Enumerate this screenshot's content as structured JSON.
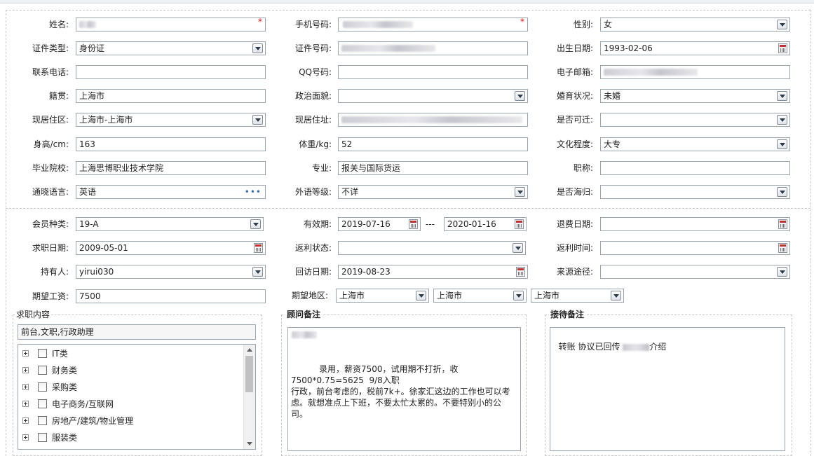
{
  "basic": {
    "name_label": "姓名:",
    "phone_label": "手机号码:",
    "gender_label": "性别:",
    "gender_value": "女",
    "id_type_label": "证件类型:",
    "id_type_value": "身份证",
    "id_number_label": "证件号码:",
    "birth_label": "出生日期:",
    "birth_value": "1993-02-06",
    "contact_label": "联系电话:",
    "qq_label": "QQ号码:",
    "email_label": "电子邮箱:",
    "native_label": "籍贯:",
    "native_value": "上海市",
    "political_label": "政治面貌:",
    "political_value": "",
    "marital_label": "婚育状况:",
    "marital_value": "未婚",
    "residence_label": "现居住区:",
    "residence_value": "上海市-上海市",
    "address_label": "现居住址:",
    "relocate_label": "是否可迁:",
    "relocate_value": "",
    "height_label": "身高/cm:",
    "height_value": "163",
    "weight_label": "体重/kg:",
    "weight_value": "52",
    "education_label": "文化程度:",
    "education_value": "大专",
    "school_label": "毕业院校:",
    "school_value": "上海思博职业技术学院",
    "major_label": "专业:",
    "major_value": "报关与国际货运",
    "title_label": "职称:",
    "title_value": "",
    "language_label": "通晓语言:",
    "language_value": "英语",
    "language_more": "•••",
    "foreign_level_label": "外语等级:",
    "foreign_level_value": "不详",
    "returnee_label": "是否海归:",
    "returnee_value": "",
    "required_mark": "*"
  },
  "member": {
    "type_label": "会员种类:",
    "type_value": "19-A",
    "valid_label": "有效期:",
    "valid_from": "2019-07-16",
    "valid_sep": "---",
    "valid_to": "2020-01-16",
    "refund_date_label": "退费日期:",
    "refund_date_value": "",
    "job_date_label": "求职日期:",
    "job_date_value": "2009-05-01",
    "rebate_status_label": "返利状态:",
    "rebate_status_value": "",
    "rebate_time_label": "返利时间:",
    "rebate_time_value": "",
    "holder_label": "持有人:",
    "holder_value": "yirui030",
    "visit_date_label": "回访日期:",
    "visit_date_value": "2019-08-23",
    "source_label": "来源途径:",
    "source_value": "",
    "salary_label": "期望工资:",
    "salary_value": "7500",
    "region_label": "期望地区:",
    "region1": "上海市",
    "region2": "上海市",
    "region3": "上海市"
  },
  "job_panel": {
    "title": "求职内容",
    "selected": "前台,文职,行政助理",
    "tree": [
      "IT类",
      "财务类",
      "采购类",
      "电子商务/互联网",
      "房地产/建筑/物业管理",
      "服装类"
    ]
  },
  "advisor_panel": {
    "title": "顾问备注",
    "note": "录用，薪资7500，试用期不打折，收\n7500*0.75=5625  9/8入职\n行政，前台考虑的，税前7k+。徐家汇这边的工作也可以考虑。就想准点上下班，不要太忙太累的。不要特别小的公司。"
  },
  "reception_panel": {
    "title": "接待备注",
    "note_prefix": "转账 协议已回传 ",
    "note_suffix": "介绍"
  }
}
